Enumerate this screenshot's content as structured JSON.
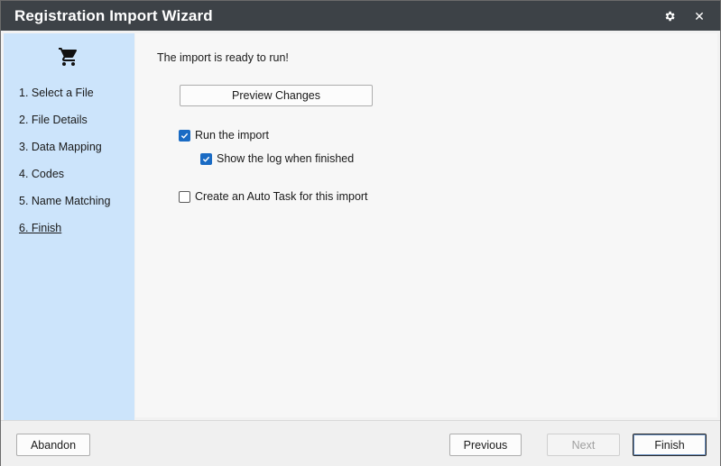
{
  "window": {
    "title": "Registration Import Wizard"
  },
  "titlebar": {
    "settings_icon": "gear-icon",
    "close_glyph": "✕"
  },
  "sidebar": {
    "icon": "shopping-cart-icon",
    "steps": [
      {
        "label": "1. Select a File"
      },
      {
        "label": "2. File Details"
      },
      {
        "label": "3. Data Mapping"
      },
      {
        "label": "4. Codes"
      },
      {
        "label": "5. Name Matching"
      },
      {
        "label": "6. Finish"
      }
    ]
  },
  "main": {
    "ready_text": "The import is ready to run!",
    "preview_label": "Preview Changes",
    "run_import": {
      "label": "Run the import",
      "checked": true
    },
    "show_log": {
      "label": "Show the log when finished",
      "checked": true
    },
    "auto_task": {
      "label": "Create an Auto Task for this import",
      "checked": false
    }
  },
  "footer": {
    "abandon_label": "Abandon",
    "previous_label": "Previous",
    "next_label": "Next",
    "finish_label": "Finish"
  },
  "colors": {
    "titlebar": "#3d4247",
    "sidebar": "#cce4fb",
    "checkbox": "#1a6bc4"
  }
}
